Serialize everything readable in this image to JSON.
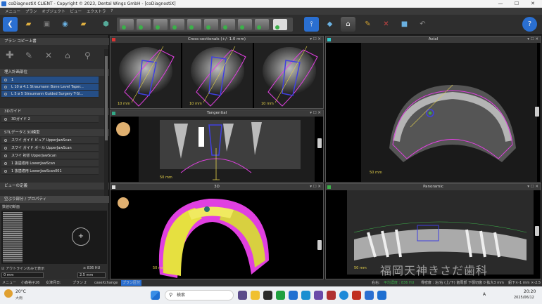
{
  "window": {
    "title": "coDiagnostiX CLIENT - Copyright © 2023, Dental Wings GmbH - [coDiagnostiX]",
    "min": "—",
    "max": "☐",
    "close": "✕"
  },
  "menu": [
    "メニュー",
    "プラン",
    "オブジェクト",
    "ビュー",
    "エクストラ",
    "?"
  ],
  "left_panel": {
    "header": "プラン  コピー上書",
    "sections": [
      {
        "title": "埋入計画部位",
        "rows": [
          {
            "label": "1",
            "selected": true
          },
          {
            "label": "L 10 ø 4.1  Straumann Bone Level Taper...",
            "selected": true
          },
          {
            "label": "L 5  ø 5  Straumann Guided Surgery T-Sl...",
            "selected": true
          }
        ]
      },
      {
        "title": "3Dガイド",
        "rows": [
          {
            "label": "3Dガイド 2",
            "selected": false
          }
        ]
      },
      {
        "title": "STLデータと3D模型",
        "rows": [
          {
            "label": "スワイ  ガイド  ピュア  UpperJawScan",
            "selected": false
          },
          {
            "label": "スワイ  ガイド  ボール  UpperJawScan",
            "selected": false
          },
          {
            "label": "スワイ  初診  UpperJawScan",
            "selected": false
          },
          {
            "label": "1  抜歯適用  LowerJawScan",
            "selected": false
          },
          {
            "label": "1  抜歯適用  LowerJawScan001",
            "selected": false
          }
        ]
      },
      {
        "title": "ビューの定義",
        "rows": []
      }
    ],
    "bottom_header": "空ぶり部分 / プロパティ",
    "bottom_sub": "数値切断面",
    "checkbox_label": "アウトラインのみで表示",
    "hu_label": "≥ 836 HU",
    "val1": "0 mm",
    "val2": "2.5 mm"
  },
  "panels": {
    "cross": {
      "title": "Cross-sectionals (+/- 1.0 mm)",
      "scale": "10 mm"
    },
    "axial": {
      "title": "Axial",
      "scale": "50 mm"
    },
    "tangential": {
      "title": "Tangential",
      "scale": "50 mm"
    },
    "view3d": {
      "title": "3D",
      "scale": "50 mm"
    },
    "panoramic": {
      "title": "Panoramic",
      "scale": "50 mm"
    }
  },
  "statusbar": {
    "left": [
      "メニュー",
      "小森裕子",
      "26",
      "女津月日:",
      "プラン 2",
      "caseXchange",
      "プラン区付"
    ],
    "right": [
      "右右:",
      "平均濃度 : 836 HU",
      "骨密度 : 左/右 (上/下) 歯周部",
      "下顎切歯 0 拡大3 mm",
      "鉛下×-1 mm ×-2.5 mm"
    ]
  },
  "taskbar": {
    "weather_temp": "20°C",
    "weather_desc": "大雨",
    "search": "検索",
    "ime": "A",
    "time": "20:20",
    "date": "2025/06/12"
  },
  "watermark": "福岡天神きさだ歯科",
  "colors": {
    "accent": "#2a6fd1",
    "magenta": "#e040e0",
    "yellow": "#e6d24a",
    "blue_implant": "#4040e0"
  }
}
